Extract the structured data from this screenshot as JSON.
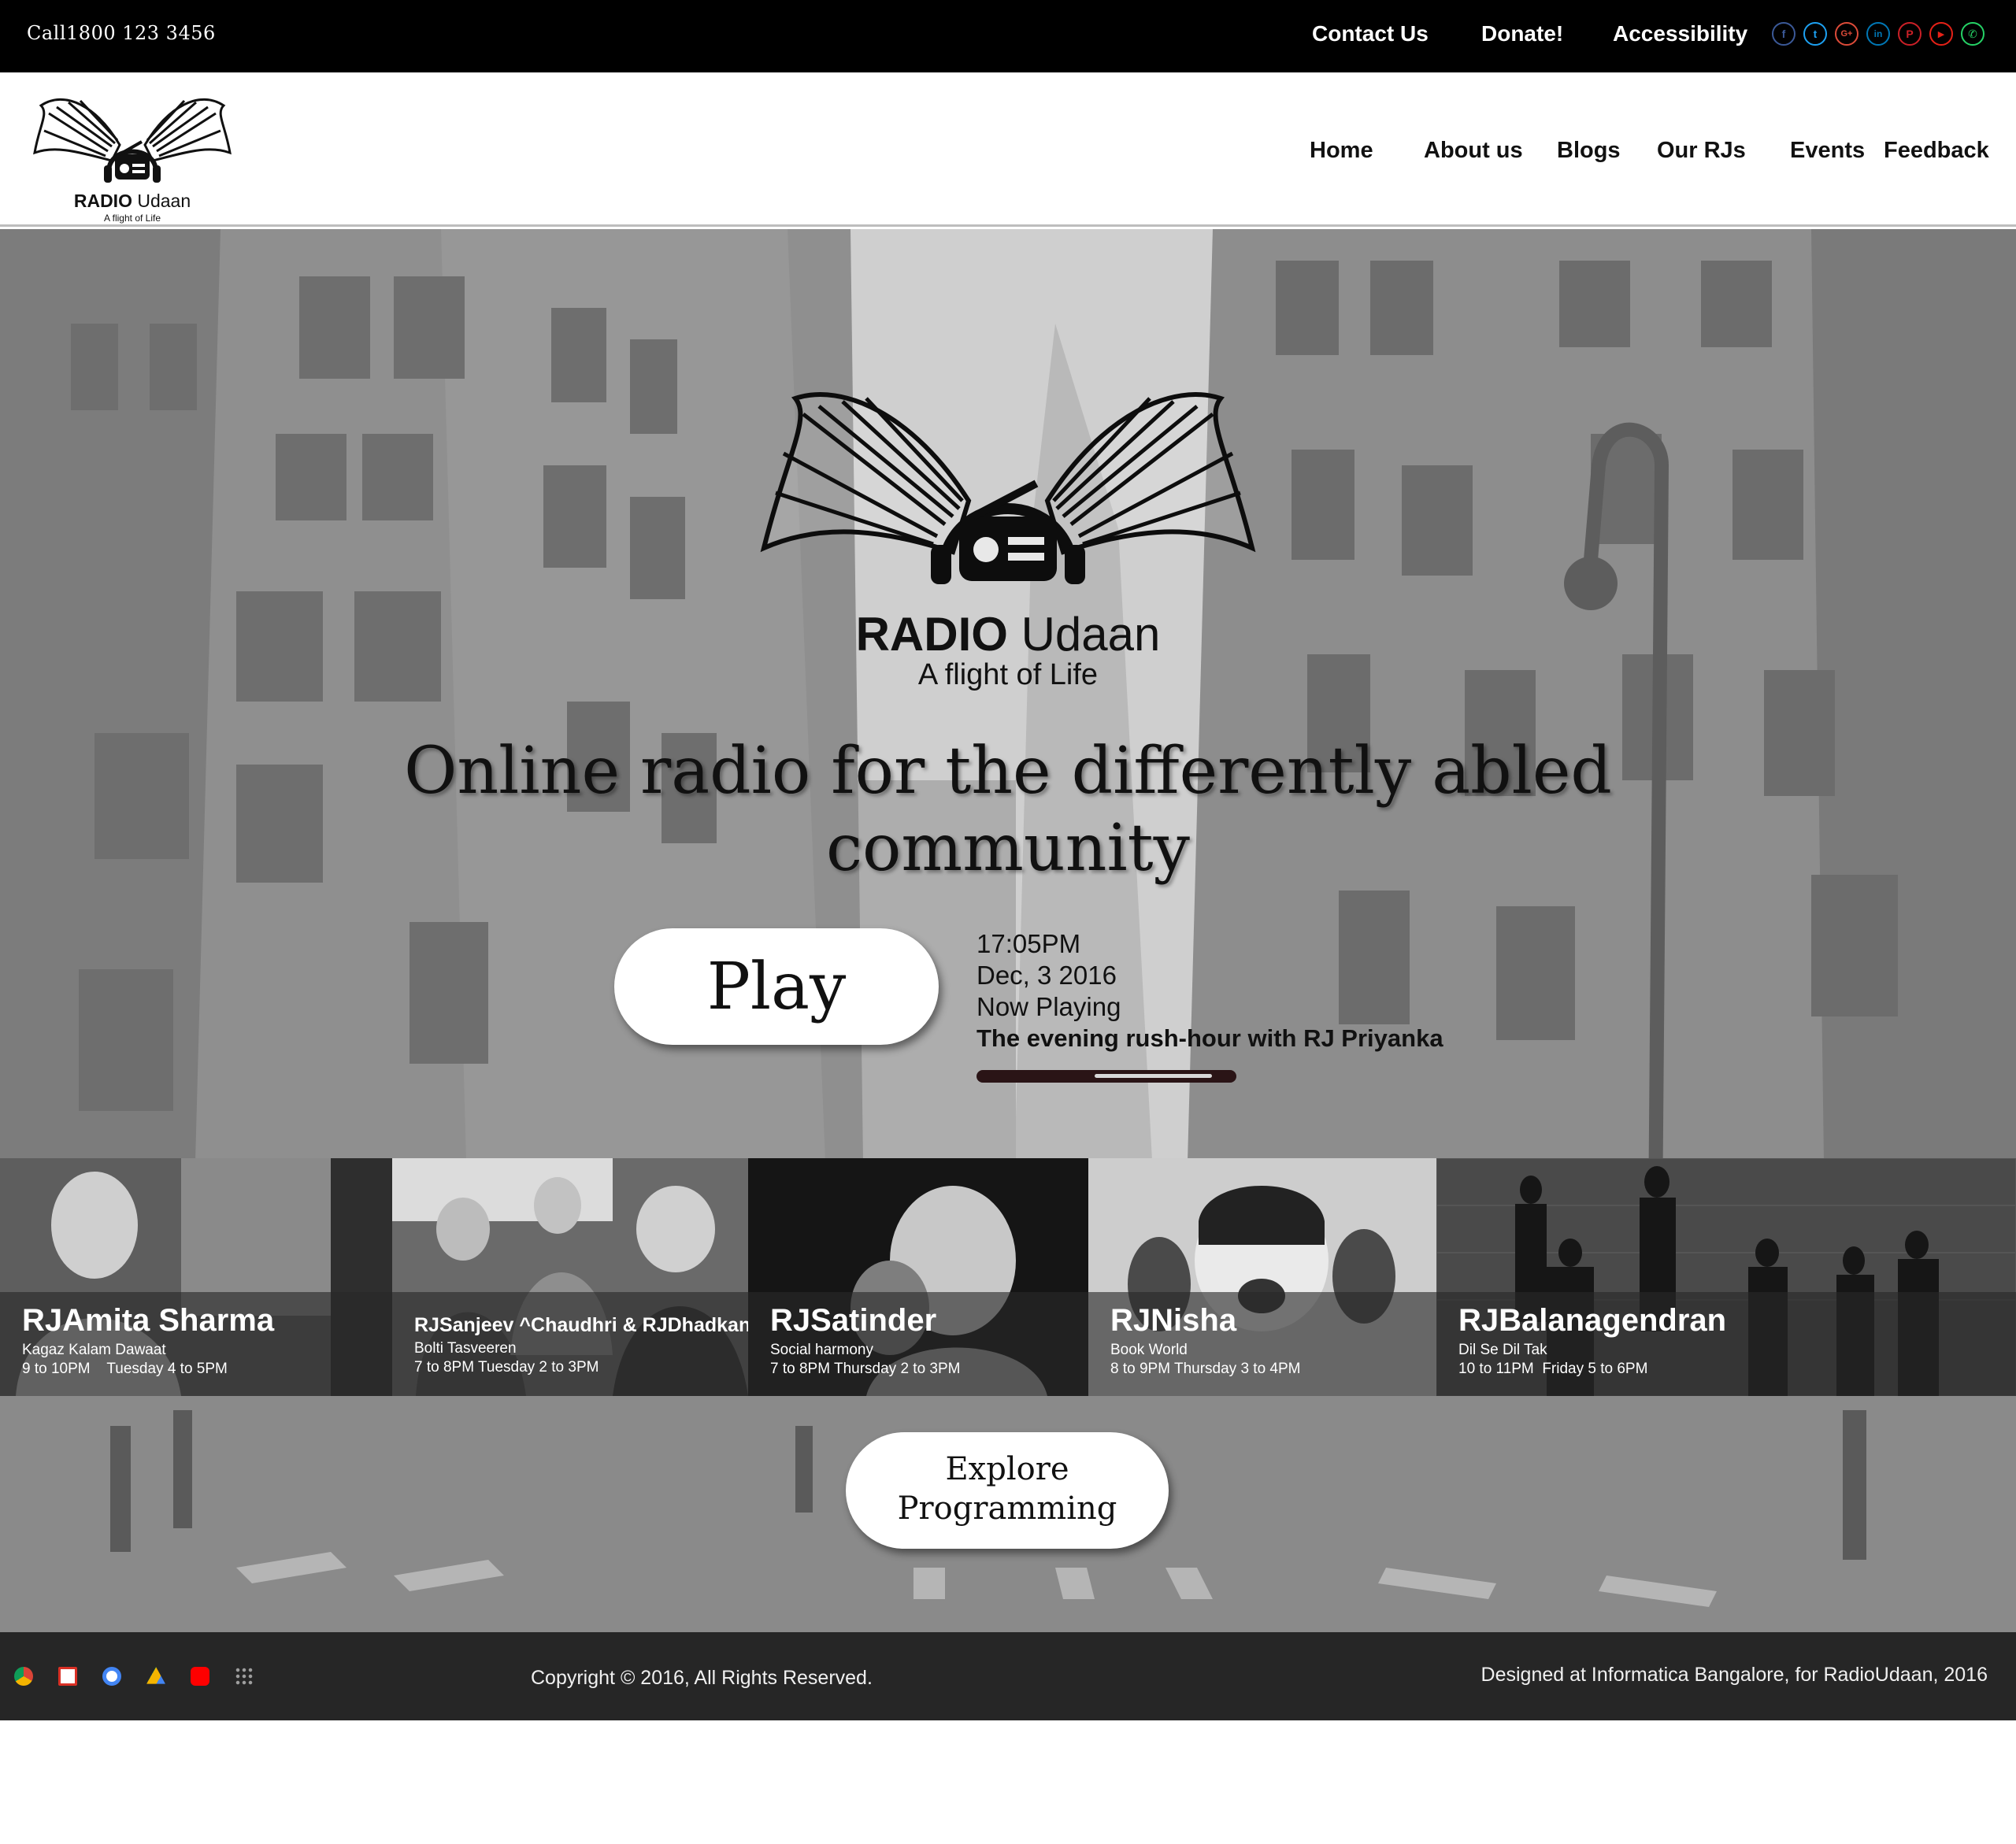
{
  "topbar": {
    "call_text": "Call1800 123 3456",
    "links": [
      "Contact Us",
      "Donate!",
      "Accessibility"
    ],
    "social": [
      {
        "icon": "facebook-icon",
        "glyph": "f",
        "color": "#3b5998"
      },
      {
        "icon": "twitter-icon",
        "glyph": "t",
        "color": "#1da1f2"
      },
      {
        "icon": "google-plus-icon",
        "glyph": "G+",
        "color": "#dd4b39"
      },
      {
        "icon": "linkedin-icon",
        "glyph": "in",
        "color": "#0077b5"
      },
      {
        "icon": "pinterest-icon",
        "glyph": "P",
        "color": "#cb2027"
      },
      {
        "icon": "youtube-icon",
        "glyph": "▶",
        "color": "#e62117"
      },
      {
        "icon": "whatsapp-icon",
        "glyph": "✆",
        "color": "#25d366"
      }
    ]
  },
  "header": {
    "brand_bold": "RADIO",
    "brand_rest": " Udaan",
    "tagline": "A flight of Life",
    "nav": [
      "Home",
      "About us",
      "Blogs",
      "Our RJs",
      "Events",
      "Feedback"
    ]
  },
  "hero": {
    "brand_bold": "RADIO",
    "brand_rest": " Udaan",
    "tagline": "A flight of Life",
    "headline": "Online radio for the differently abled community",
    "play_label": "Play",
    "time": "17:05PM",
    "date": "Dec, 3 2016",
    "now_playing_label": "Now Playing",
    "show": "The evening rush-hour with RJ Priyanka",
    "progress": 0.45
  },
  "rjs": [
    {
      "name": "RJAmita Sharma",
      "show": "Kagaz Kalam Dawaat",
      "time": "9 to 10PM    Tuesday 4 to 5PM"
    },
    {
      "name": "RJSanjeev ^Chaudhri & RJDhadkan",
      "show": "Bolti Tasveeren",
      "time": "7 to 8PM Tuesday 2 to 3PM"
    },
    {
      "name": "RJSatinder",
      "show": "Social harmony",
      "time": "7 to 8PM Thursday 2 to 3PM"
    },
    {
      "name": "RJNisha",
      "show": "Book World",
      "time": "8 to 9PM Thursday 3 to 4PM"
    },
    {
      "name": "RJBalanagendran",
      "show": "Dil Se Dil Tak",
      "time": "10 to 11PM  Friday 5 to 6PM"
    }
  ],
  "explore_label": "Explore Programming",
  "footer": {
    "apps": [
      {
        "icon": "chrome-icon",
        "color": "#4caf50"
      },
      {
        "icon": "gmail-icon",
        "color": "#e53935"
      },
      {
        "icon": "google-icon",
        "color": "#4285f4"
      },
      {
        "icon": "drive-icon",
        "color": "#fbbc05"
      },
      {
        "icon": "youtube-icon",
        "color": "#ff0000"
      },
      {
        "icon": "apps-grid-icon",
        "color": "#9e9e9e"
      }
    ],
    "copyright": "Copyright © 2016, All Rights Reserved.",
    "designed": "Designed at Informatica Bangalore, for  RadioUdaan, 2016"
  }
}
